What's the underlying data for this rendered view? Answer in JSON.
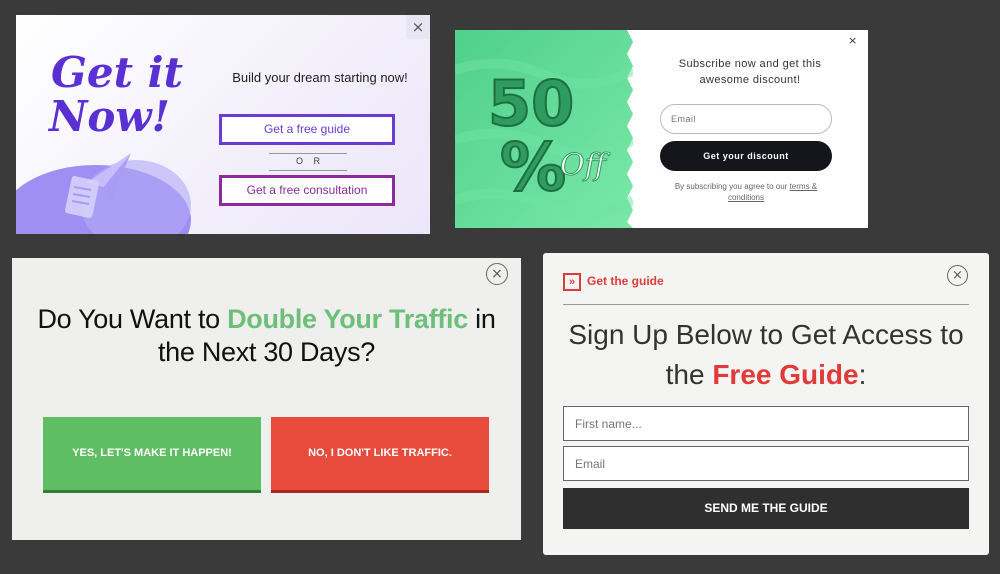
{
  "popup1": {
    "art_text_line1": "Get it",
    "art_text_line2": "Now!",
    "close_glyph": "×",
    "headline": "Build your dream starting now!",
    "guide_button": "Get a free guide",
    "or_text": "O R",
    "consult_button": "Get a free consultation",
    "colors": {
      "purple": "#6a3bd6",
      "magenta": "#8c2b9e"
    },
    "icons": [
      "close-icon",
      "paper-plane-icon",
      "document-icon"
    ]
  },
  "popup2": {
    "discount_number": "50",
    "discount_percent": "%",
    "discount_off": "Off",
    "close_glyph": "×",
    "headline": "Subscribe now and get this awesome discount!",
    "email_placeholder": "Email",
    "submit_button": "Get your discount",
    "terms_prefix": "By subscribing you agree to our ",
    "terms_link": "terms & conditions",
    "colors": {
      "green": "#5ddc95",
      "button": "#14161c"
    }
  },
  "popup3": {
    "close_glyph": "×",
    "headline_part1": "Do You Want to ",
    "headline_highlight": "Double Your Traffic",
    "headline_part2": " in the Next 30 Days?",
    "yes_button": "YES, LET'S MAKE IT HAPPEN!",
    "no_button": "NO, I DON'T LIKE TRAFFIC.",
    "colors": {
      "green": "#5fbe63",
      "red": "#e74b3c",
      "highlight": "#6cc07a"
    }
  },
  "popup4": {
    "tag_icon": "»",
    "tag_text": "Get the guide",
    "close_glyph": "×",
    "headline_part1": "Sign Up Below to Get Access to the ",
    "headline_highlight": "Free Guide",
    "headline_part2": ":",
    "first_name_placeholder": "First name...",
    "email_placeholder": "Email",
    "submit_button": "SEND ME THE GUIDE",
    "colors": {
      "accent": "#e03b3b",
      "button": "#2f2f2f"
    }
  }
}
